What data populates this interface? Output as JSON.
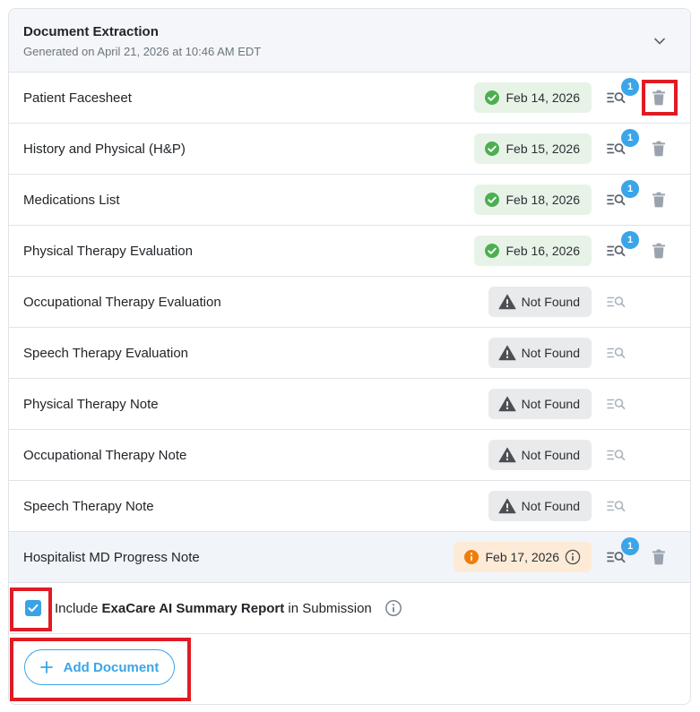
{
  "header": {
    "title": "Document Extraction",
    "subtitle": "Generated on April 21, 2026 at 10:46 AM EDT",
    "collapse_icon": "chevron-down-icon"
  },
  "documents": [
    {
      "name": "Patient Facesheet",
      "status": "found",
      "date": "Feb 14, 2026",
      "count": "1",
      "has_delete": true
    },
    {
      "name": "History and Physical (H&P)",
      "status": "found",
      "date": "Feb 15, 2026",
      "count": "1",
      "has_delete": true
    },
    {
      "name": "Medications List",
      "status": "found",
      "date": "Feb 18, 2026",
      "count": "1",
      "has_delete": true
    },
    {
      "name": "Physical Therapy Evaluation",
      "status": "found",
      "date": "Feb 16, 2026",
      "count": "1",
      "has_delete": true
    },
    {
      "name": "Occupational Therapy Evaluation",
      "status": "missing",
      "date": "Not Found",
      "count": "",
      "has_delete": false
    },
    {
      "name": "Speech Therapy Evaluation",
      "status": "missing",
      "date": "Not Found",
      "count": "",
      "has_delete": false
    },
    {
      "name": "Physical Therapy Note",
      "status": "missing",
      "date": "Not Found",
      "count": "",
      "has_delete": false
    },
    {
      "name": "Occupational Therapy Note",
      "status": "missing",
      "date": "Not Found",
      "count": "",
      "has_delete": false
    },
    {
      "name": "Speech Therapy Note",
      "status": "missing",
      "date": "Not Found",
      "count": "",
      "has_delete": false
    },
    {
      "name": "Hospitalist MD Progress Note",
      "status": "warning",
      "date": "Feb 17, 2026",
      "count": "1",
      "has_delete": true
    }
  ],
  "include": {
    "checked": true,
    "prefix": "Include ",
    "bold": "ExaCare AI Summary Report",
    "suffix": " in Submission"
  },
  "add_button": {
    "label": "Add Document"
  },
  "colors": {
    "accent": "#3aa5e8",
    "found_bg": "#e8f3e8",
    "found_icon": "#4caf50",
    "missing_bg": "#e9eaeb",
    "warning_bg": "#fdebd8",
    "warning_icon": "#ef7d0a",
    "highlight_red": "#e01b24"
  }
}
